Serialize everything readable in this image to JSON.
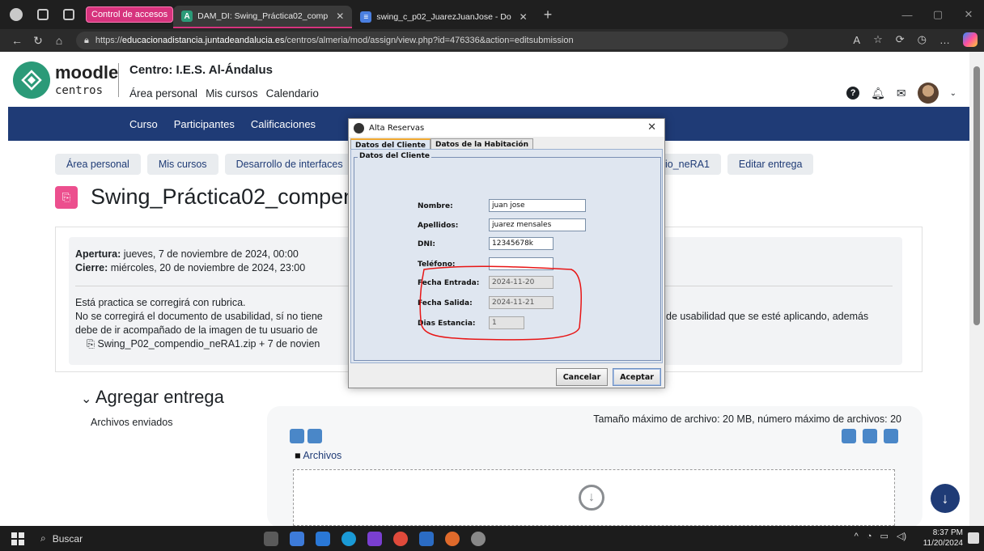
{
  "browser": {
    "group_label": "Control de accesos",
    "tabs": [
      {
        "label": "DAM_DI: Swing_Práctica02_comp",
        "icon": "A"
      },
      {
        "label": "swing_c_p02_JuarezJuanJose - Do",
        "icon": "≡"
      }
    ],
    "url_prefix": "https://",
    "url_host": "educacionadistancia.juntadeandalucia.es",
    "url_path": "/centros/almeria/mod/assign/view.php?id=476336&action=editsubmission"
  },
  "moodle": {
    "logo_text": "moodle",
    "logo_sub": "centros",
    "centro": "Centro: I.E.S. Al-Ándalus",
    "nav": [
      "Área personal",
      "Mis cursos",
      "Calendario"
    ],
    "bluebar": [
      "Curso",
      "Participantes",
      "Calificaciones"
    ],
    "breadcrumb": [
      "Área personal",
      "Mis cursos",
      "Desarrollo de interfaces"
    ],
    "breadcrumb_tail": [
      "io_neRA1",
      "Editar entrega"
    ],
    "page_title": "Swing_Práctica02_compen",
    "apertura_label": "Apertura:",
    "apertura_value": " jueves, 7 de noviembre de 2024, 00:00",
    "cierre_label": "Cierre:",
    "cierre_value": " miércoles, 20 de noviembre de 2024, 23:00",
    "desc1": "Está practica se corregirá con rubrica.",
    "desc2": "No se corregirá el documento de usabilidad, sí no tiene",
    "desc2_tail": "de usabilidad que se esté aplicando, además",
    "desc3": "debe de ir acompañado de la imagen de tu usuario de",
    "file_name": "Swing_P02_compendio_neRA1.zip",
    "file_date": "7 de novien",
    "agregar": "Agregar entrega",
    "archivos_enviados": "Archivos enviados",
    "tamano": "Tamaño máximo de archivo: 20 MB, número máximo de archivos: 20",
    "folder": "Archivos"
  },
  "dialog": {
    "title": "Alta Reservas",
    "tabs": [
      "Datos del Cliente",
      "Datos de la Habitación"
    ],
    "group_title": "Datos del Cliente",
    "fields": {
      "nombre_label": "Nombre:",
      "nombre_value": "juan jose",
      "apellidos_label": "Apellidos:",
      "apellidos_value": "juarez mensales",
      "dni_label": "DNI:",
      "dni_value": "12345678k",
      "telefono_label": "Teléfono:",
      "telefono_value": "",
      "fecha_entrada_label": "Fecha Entrada:",
      "fecha_entrada_value": "2024-11-20",
      "fecha_salida_label": "Fecha Salida:",
      "fecha_salida_value": "2024-11-21",
      "dias_label": "Dias Estancia:",
      "dias_value": "1"
    },
    "cancel": "Cancelar",
    "accept": "Aceptar"
  },
  "taskbar": {
    "search": "Buscar",
    "time": "8:37 PM",
    "date": "11/20/2024"
  }
}
